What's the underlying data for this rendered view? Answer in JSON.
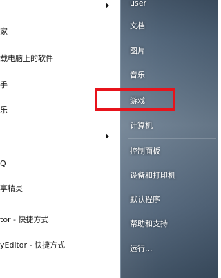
{
  "left_list": {
    "items": [
      {
        "label": "家",
        "has_submenu": false
      },
      {
        "label": "载电脑上的软件",
        "has_submenu": false
      },
      {
        "label": "手",
        "has_submenu": false
      },
      {
        "label": "乐",
        "has_submenu": false
      },
      {
        "label": "",
        "has_submenu": true
      },
      {
        "label": "Q",
        "has_submenu": false
      },
      {
        "label": "享精灵",
        "has_submenu": false
      },
      {
        "label": "tor - 快捷方式",
        "has_submenu": false
      },
      {
        "label": "yEditor - 快捷方式",
        "has_submenu": false
      }
    ],
    "top_submenu_arrow": true
  },
  "right_panel": {
    "user": "user",
    "items": [
      {
        "label": "文档"
      },
      {
        "label": "图片"
      },
      {
        "label": "音乐"
      },
      {
        "label": "游戏"
      },
      {
        "label": "计算机"
      },
      {
        "label": "控制面板"
      },
      {
        "label": "设备和打印机"
      },
      {
        "label": "默认程序"
      },
      {
        "label": "帮助和支持"
      },
      {
        "label": "运行..."
      }
    ]
  },
  "annotation": {
    "color": "#e8131b",
    "target": "游戏"
  }
}
